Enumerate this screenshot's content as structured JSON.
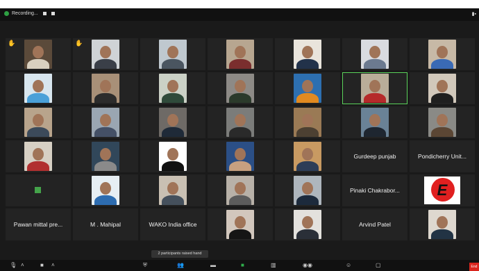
{
  "recording": {
    "label": "Recording...",
    "dot_color": "#2ea043"
  },
  "tooltip": "2 participants raised hand",
  "end_label": "End",
  "accent_active": "#5ad35a",
  "tiles": [
    {
      "type": "video",
      "bg": "#5b4a3a",
      "shirt": "#d9d0c0",
      "hand": true
    },
    {
      "type": "video",
      "bg": "#cfd3d6",
      "shirt": "#3a3f48",
      "hand": true
    },
    {
      "type": "video",
      "bg": "#bfc8cf",
      "shirt": "#4a5560"
    },
    {
      "type": "video",
      "bg": "#b7a690",
      "shirt": "#7a2e2e"
    },
    {
      "type": "video",
      "bg": "#e9e4dc",
      "shirt": "#22324a"
    },
    {
      "type": "video",
      "bg": "#d9dbe0",
      "shirt": "#6c7a90"
    },
    {
      "type": "video",
      "bg": "#c7b9a6",
      "shirt": "#3a6ab5"
    },
    {
      "type": "video",
      "bg": "#d8e6ef",
      "shirt": "#4aa0d8"
    },
    {
      "type": "video",
      "bg": "#a89078",
      "shirt": "#2c2c2c"
    },
    {
      "type": "video",
      "bg": "#cbd1c6",
      "shirt": "#2f4a3a"
    },
    {
      "type": "video",
      "bg": "#8d8a86",
      "shirt": "#2b3a2b"
    },
    {
      "type": "video",
      "bg": "#2d6fb0",
      "shirt": "#e18a20"
    },
    {
      "type": "video",
      "bg": "#b9ad99",
      "shirt": "#b52a2a",
      "active": true
    },
    {
      "type": "video",
      "bg": "#d1c8bb",
      "shirt": "#1f1f1f"
    },
    {
      "type": "video",
      "bg": "#b8a48c",
      "shirt": "#3c4a5a"
    },
    {
      "type": "video",
      "bg": "#9aa6b2",
      "shirt": "#445066"
    },
    {
      "type": "video",
      "bg": "#6e6a66",
      "shirt": "#1f2a38"
    },
    {
      "type": "video",
      "bg": "#7b7c7a",
      "shirt": "#2a2a2a"
    },
    {
      "type": "video",
      "bg": "#9a7a55",
      "shirt": "#4c4032"
    },
    {
      "type": "video",
      "bg": "#6a8296",
      "shirt": "#1e2630"
    },
    {
      "type": "video",
      "bg": "#8a8a86",
      "shirt": "#5b4634"
    },
    {
      "type": "video",
      "bg": "#d7d0c4",
      "shirt": "#b13030"
    },
    {
      "type": "video",
      "bg": "#31475a",
      "shirt": "#8a8a8a"
    },
    {
      "type": "video",
      "bg": "#ffffff",
      "shirt": "#111111"
    },
    {
      "type": "video",
      "bg": "#2b4f86",
      "shirt": "#c7a080"
    },
    {
      "type": "video",
      "bg": "#c89a62",
      "shirt": "#2d3d57"
    },
    {
      "type": "name",
      "name": "Gurdeep punjab"
    },
    {
      "type": "name",
      "name": "Pondicherry Unit..."
    },
    {
      "type": "avatar"
    },
    {
      "type": "video",
      "bg": "#e6eef3",
      "shirt": "#2d6cb0"
    },
    {
      "type": "video",
      "bg": "#c9c0b3",
      "shirt": "#45505c"
    },
    {
      "type": "video",
      "bg": "#b8b1a8",
      "shirt": "#5c5c5c"
    },
    {
      "type": "video",
      "bg": "#aeb6bd",
      "shirt": "#1c2a3c"
    },
    {
      "type": "name",
      "name": "Pinaki Chakrabor..."
    },
    {
      "type": "logo"
    },
    {
      "type": "name",
      "name": "Pawan mittal pre..."
    },
    {
      "type": "name",
      "name": "M . Mahipal"
    },
    {
      "type": "name",
      "name": "WAKO India office"
    },
    {
      "type": "video",
      "bg": "#d2c7bd",
      "shirt": "#151515"
    },
    {
      "type": "video",
      "bg": "#e3e1dd",
      "shirt": "#2a2f38"
    },
    {
      "type": "name",
      "name": "Arvind Patel"
    },
    {
      "type": "video",
      "bg": "#ded8cf",
      "shirt": "#223344"
    }
  ]
}
